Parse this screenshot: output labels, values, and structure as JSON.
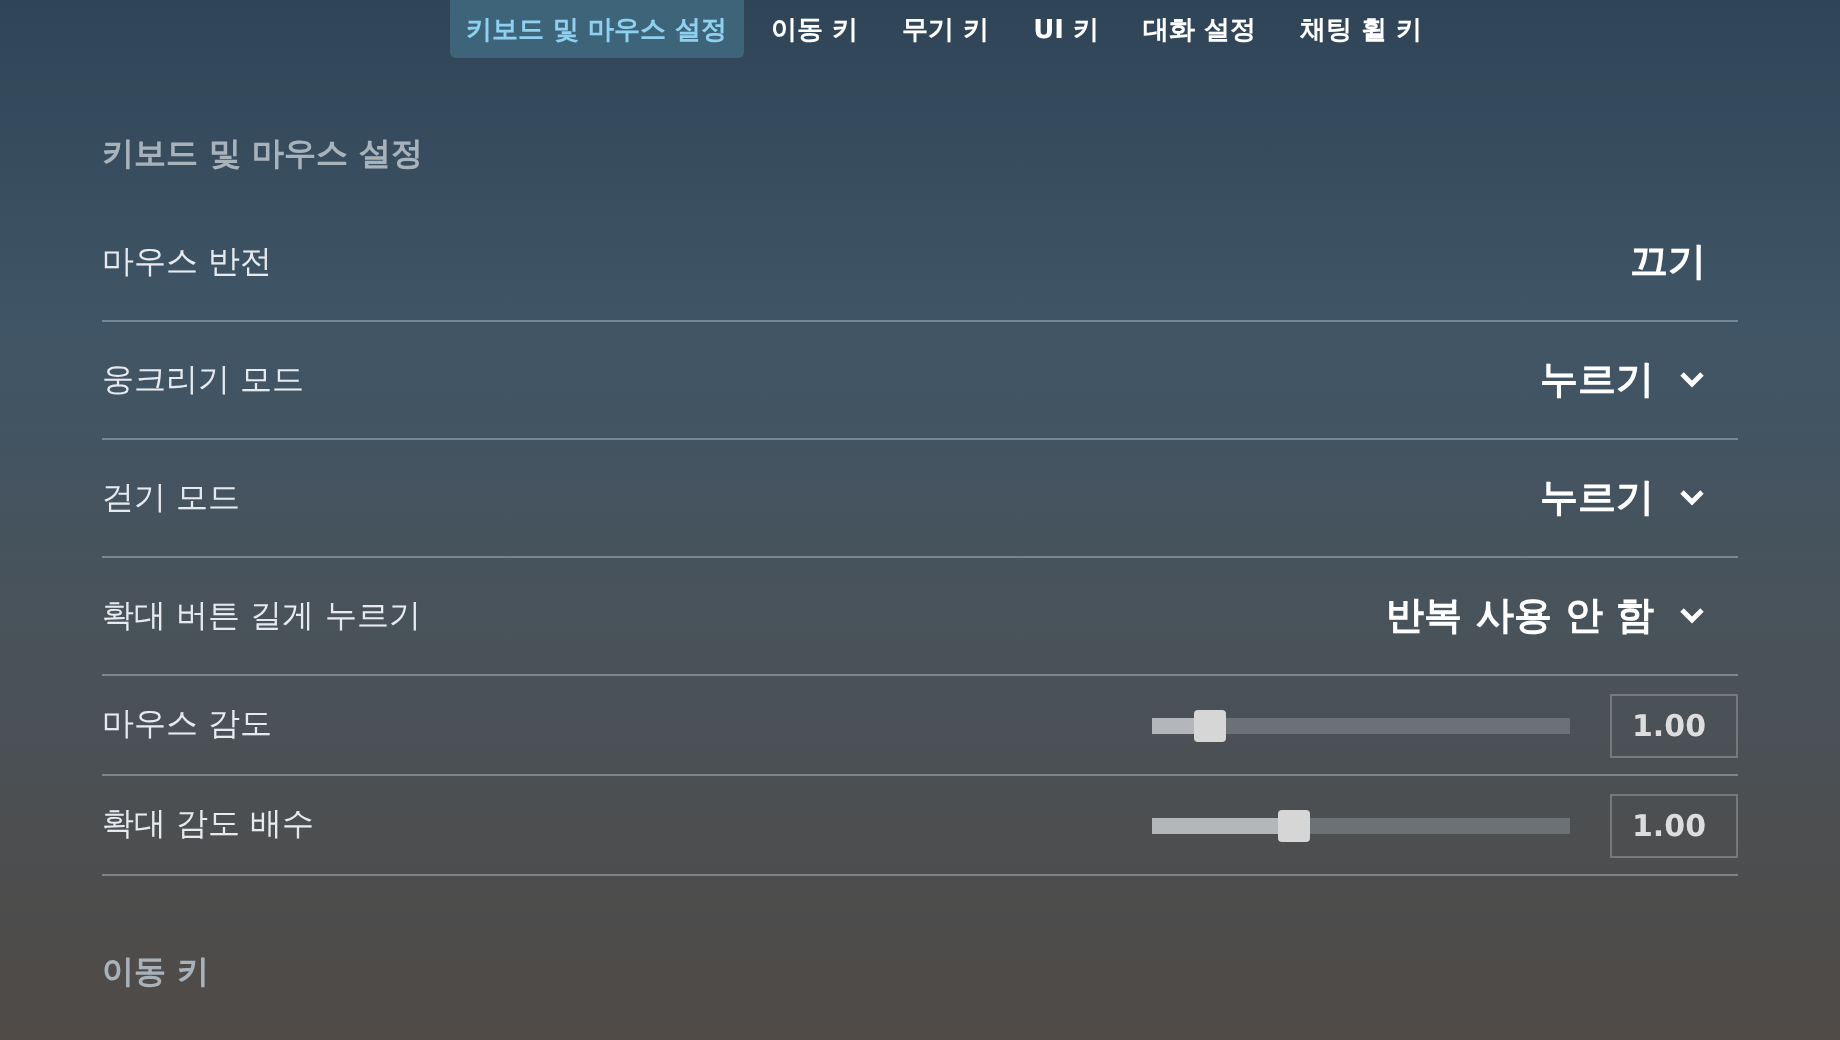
{
  "tabs": [
    {
      "label": "키보드 및 마우스 설정",
      "selected": true
    },
    {
      "label": "이동 키",
      "selected": false
    },
    {
      "label": "무기 키",
      "selected": false
    },
    {
      "label": "UI 키",
      "selected": false
    },
    {
      "label": "대화 설정",
      "selected": false
    },
    {
      "label": "채팅 휠 키",
      "selected": false
    }
  ],
  "sections": [
    {
      "title": "키보드 및 마우스 설정",
      "rows": [
        {
          "kind": "toggle",
          "label": "마우스 반전",
          "value": "끄기"
        },
        {
          "kind": "dropdown",
          "label": "웅크리기 모드",
          "value": "누르기"
        },
        {
          "kind": "dropdown",
          "label": "걷기 모드",
          "value": "누르기"
        },
        {
          "kind": "dropdown",
          "label": "확대 버튼 길게 누르기",
          "value": "반복 사용 안 함"
        },
        {
          "kind": "slider",
          "label": "마우스 감도",
          "level": 0.14,
          "value": "1.00"
        },
        {
          "kind": "slider",
          "label": "확대 감도 배수",
          "level": 0.34,
          "value": "1.00"
        }
      ]
    },
    {
      "title": "이동 키"
    }
  ]
}
